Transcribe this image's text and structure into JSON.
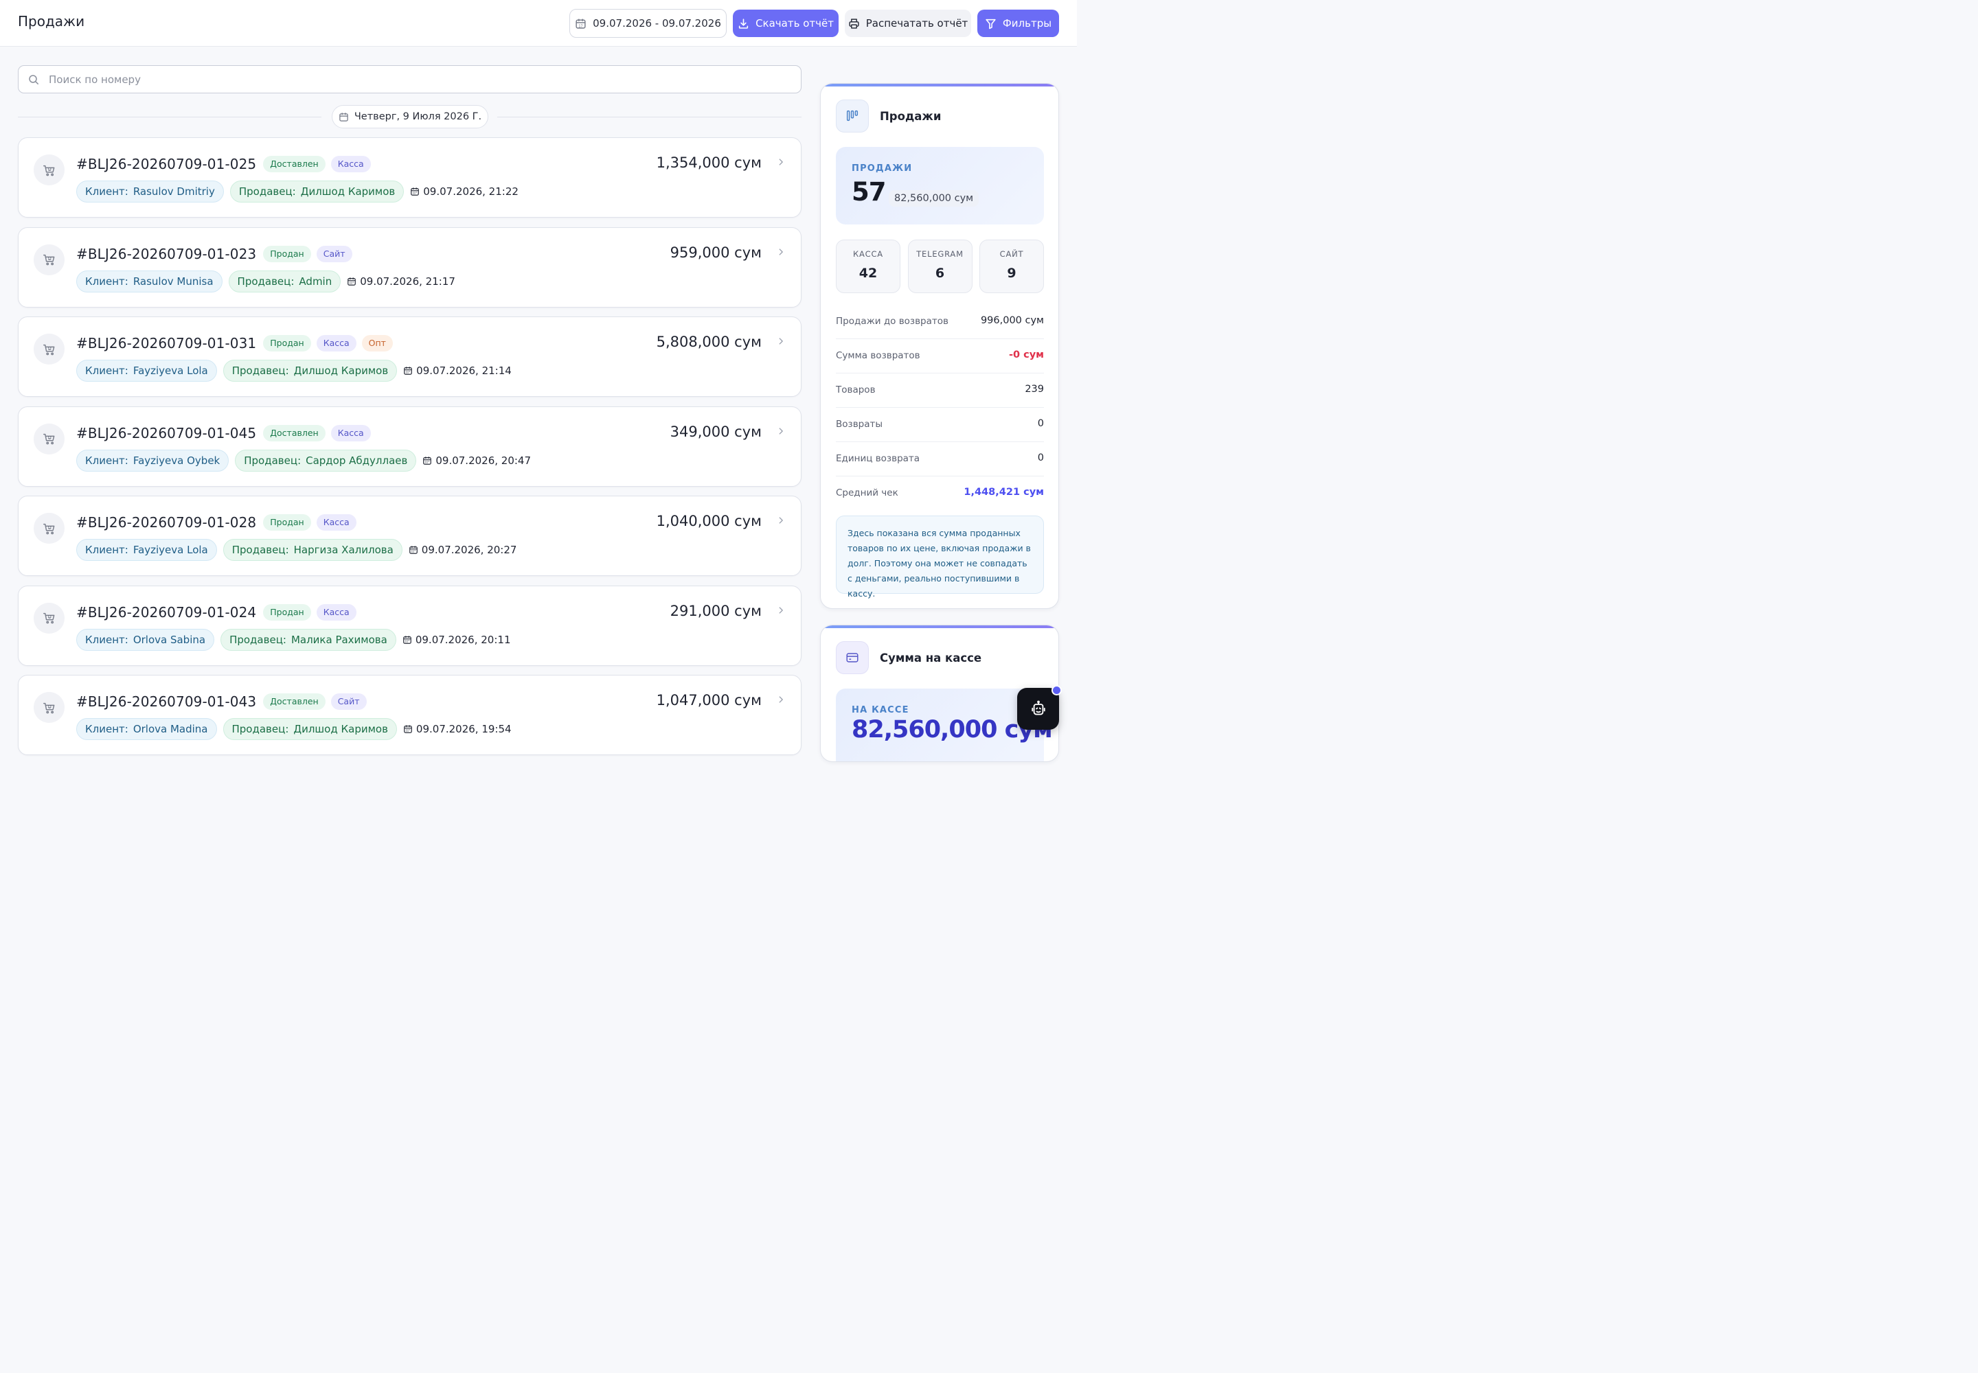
{
  "header": {
    "title": "Продажи",
    "date_range": "09.07.2026 - 09.07.2026",
    "download_label": "Скачать отчёт",
    "print_label": "Распечатать отчёт",
    "filters_label": "Фильтры"
  },
  "search": {
    "placeholder": "Поиск по номеру",
    "value": ""
  },
  "date_divider": "Четверг, 9 Июля 2026 Г.",
  "orders": [
    {
      "number": "#BLJ26-20260709-01-025",
      "status": "Доставлен",
      "channel": "Касса",
      "extra": "",
      "client_label": "Клиент:",
      "client": "Rasulov Dmitriy",
      "seller_label": "Продавец:",
      "seller": "Дилшод Каримов",
      "datetime": "09.07.2026, 21:22",
      "amount": "1,354,000 сум"
    },
    {
      "number": "#BLJ26-20260709-01-023",
      "status": "Продан",
      "channel": "Сайт",
      "extra": "",
      "client_label": "Клиент:",
      "client": "Rasulov Munisa",
      "seller_label": "Продавец:",
      "seller": "Admin",
      "datetime": "09.07.2026, 21:17",
      "amount": "959,000 сум"
    },
    {
      "number": "#BLJ26-20260709-01-031",
      "status": "Продан",
      "channel": "Касса",
      "extra": "Опт",
      "client_label": "Клиент:",
      "client": "Fayziyeva Lola",
      "seller_label": "Продавец:",
      "seller": "Дилшод Каримов",
      "datetime": "09.07.2026, 21:14",
      "amount": "5,808,000 сум"
    },
    {
      "number": "#BLJ26-20260709-01-045",
      "status": "Доставлен",
      "channel": "Касса",
      "extra": "",
      "client_label": "Клиент:",
      "client": "Fayziyeva Oybek",
      "seller_label": "Продавец:",
      "seller": "Сардор Абдуллаев",
      "datetime": "09.07.2026, 20:47",
      "amount": "349,000 сум"
    },
    {
      "number": "#BLJ26-20260709-01-028",
      "status": "Продан",
      "channel": "Касса",
      "extra": "",
      "client_label": "Клиент:",
      "client": "Fayziyeva Lola",
      "seller_label": "Продавец:",
      "seller": "Наргиза Халилова",
      "datetime": "09.07.2026, 20:27",
      "amount": "1,040,000 сум"
    },
    {
      "number": "#BLJ26-20260709-01-024",
      "status": "Продан",
      "channel": "Касса",
      "extra": "",
      "client_label": "Клиент:",
      "client": "Orlova Sabina",
      "seller_label": "Продавец:",
      "seller": "Малика Рахимова",
      "datetime": "09.07.2026, 20:11",
      "amount": "291,000 сум"
    },
    {
      "number": "#BLJ26-20260709-01-043",
      "status": "Доставлен",
      "channel": "Сайт",
      "extra": "",
      "client_label": "Клиент:",
      "client": "Orlova Madina",
      "seller_label": "Продавец:",
      "seller": "Дилшод Каримов",
      "datetime": "09.07.2026, 19:54",
      "amount": "1,047,000 сум"
    }
  ],
  "sales_panel": {
    "title": "Продажи",
    "hero_label": "ПРОДАЖИ",
    "hero_count": "57",
    "hero_sum": "82,560,000 сум",
    "channels": [
      {
        "label": "КАССА",
        "value": "42"
      },
      {
        "label": "TELEGRAM",
        "value": "6"
      },
      {
        "label": "САЙТ",
        "value": "9"
      }
    ],
    "stats": [
      {
        "label": "Продажи до возвратов",
        "value": "996,000 сум",
        "tone": "normal"
      },
      {
        "label": "Сумма возвратов",
        "value": "-0 сум",
        "tone": "red"
      },
      {
        "label": "Товаров",
        "value": "239",
        "tone": "normal"
      },
      {
        "label": "Возвраты",
        "value": "0",
        "tone": "normal"
      },
      {
        "label": "Единиц возврата",
        "value": "0",
        "tone": "normal"
      },
      {
        "label": "Средний чек",
        "value": "1,448,421 сум",
        "tone": "accent"
      }
    ],
    "note": "Здесь показана вся сумма проданных товаров по их цене, включая продажи в долг. Поэтому она может не совпадать с деньгами, реально поступившими в кассу."
  },
  "cash_panel": {
    "title": "Сумма на кассе",
    "label": "НА КАССЕ",
    "value": "82,560,000 сум"
  },
  "colors": {
    "accent": "#6b6cf5",
    "danger": "#e0324b",
    "status_green": "#1b7a4c",
    "channel_purple": "#5556c8",
    "wholesale_orange": "#c5612a"
  },
  "icons": {
    "date_button": "calendar-icon",
    "download": "download-icon",
    "print": "printer-icon",
    "filters": "filter-icon",
    "search": "search-icon",
    "order": "cart-icon",
    "chevron": "chevron-right-icon",
    "sales_panel": "bar-chart-icon",
    "cash_panel": "card-icon",
    "bot": "robot-icon"
  }
}
